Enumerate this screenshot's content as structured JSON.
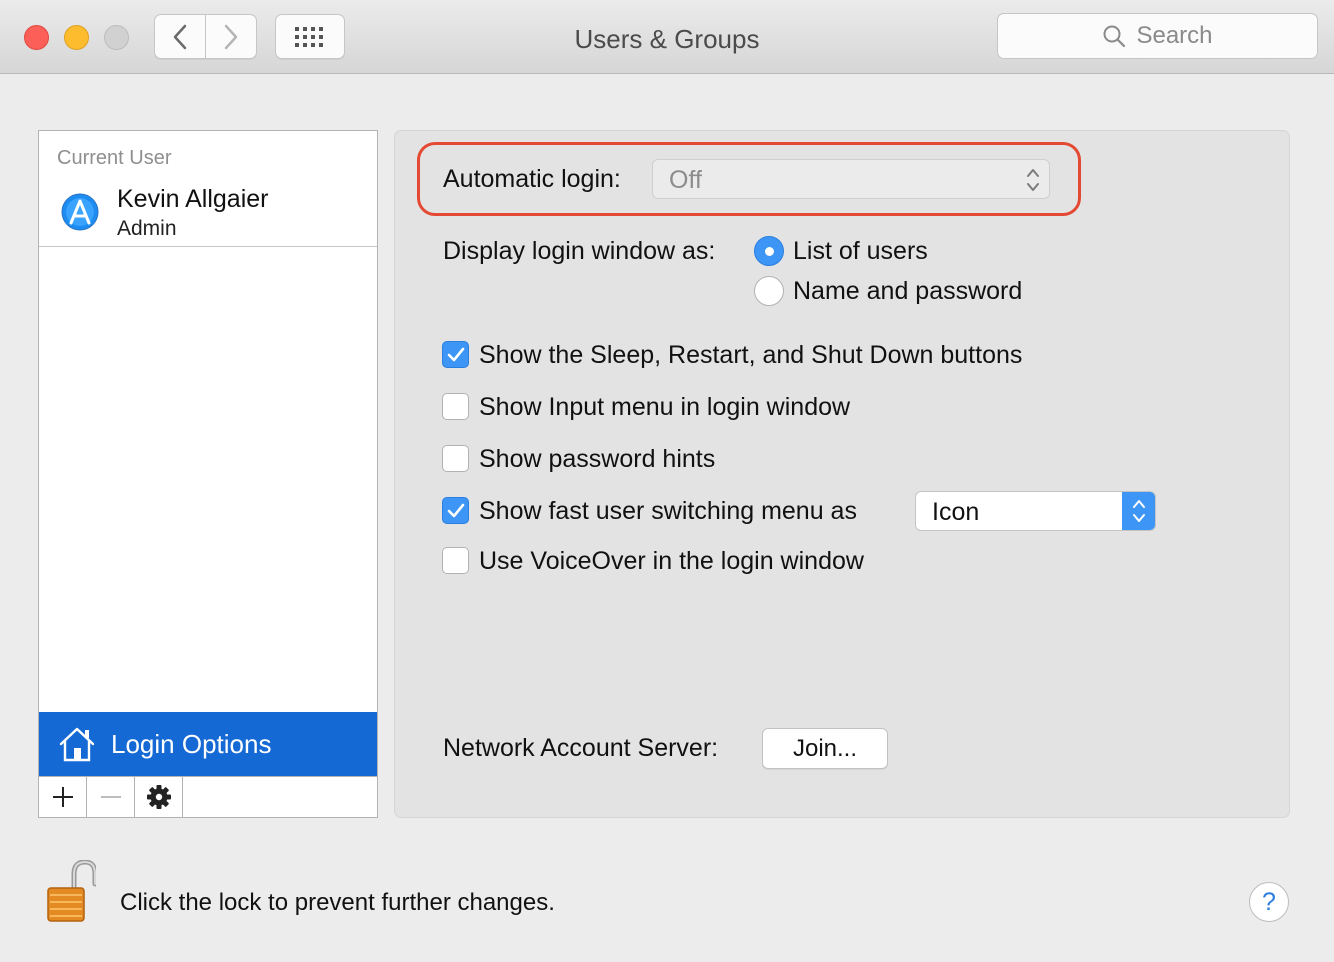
{
  "window": {
    "title": "Users & Groups",
    "search_placeholder": "Search"
  },
  "sidebar": {
    "section_label": "Current User",
    "user_name": "Kevin Allgaier",
    "user_role": "Admin",
    "login_options_label": "Login Options",
    "selected_color": "#1569d4"
  },
  "login": {
    "automatic_login_label": "Automatic login:",
    "automatic_login_value": "Off",
    "display_as_label": "Display login window as:",
    "radio_list_of_users": "List of users",
    "radio_name_and_password": "Name and password",
    "radio_selected": "List of users",
    "options": [
      {
        "label": "Show the Sleep, Restart, and Shut Down buttons",
        "checked": true
      },
      {
        "label": "Show Input menu in login window",
        "checked": false
      },
      {
        "label": "Show password hints",
        "checked": false
      },
      {
        "label": "Show fast user switching menu as",
        "checked": true
      },
      {
        "label": "Use VoiceOver in the login window",
        "checked": false
      }
    ],
    "fast_switch_value": "Icon",
    "network_server_label": "Network Account Server:",
    "join_button": "Join..."
  },
  "footer": {
    "lock_text": "Click the lock to prevent further changes.",
    "help_label": "?"
  },
  "colors": {
    "accent": "#3d95f5",
    "highlight_outline": "#e44a33"
  }
}
